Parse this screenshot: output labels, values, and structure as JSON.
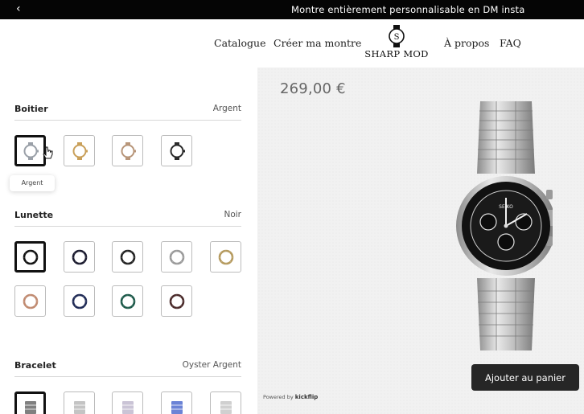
{
  "announcement": {
    "back_icon": "chevron-left-icon",
    "text": "Montre entièrement personnalisable en DM insta"
  },
  "nav": {
    "catalogue": "Catalogue",
    "create": "Créer ma montre",
    "about": "À propos",
    "faq": "FAQ",
    "logo_text": "SHARP MOD"
  },
  "configurator": {
    "sections": [
      {
        "title": "Boitier",
        "value": "Argent",
        "options": [
          {
            "name": "Argent",
            "color": "#9aa0a8",
            "selected": true
          },
          {
            "name": "Or",
            "color": "#c9a05a",
            "selected": false
          },
          {
            "name": "Or rose",
            "color": "#b8967a",
            "selected": false
          },
          {
            "name": "Noir",
            "color": "#2a2a2a",
            "selected": false
          }
        ]
      },
      {
        "title": "Lunette",
        "value": "Noir",
        "options": [
          {
            "color": "#111111",
            "selected": true
          },
          {
            "color": "#1a1a2e",
            "selected": false
          },
          {
            "color": "#222222",
            "selected": false
          },
          {
            "color": "#9a9a9a",
            "selected": false
          },
          {
            "color": "#b59a5e",
            "selected": false
          },
          {
            "color": "#c08a70",
            "selected": false
          },
          {
            "color": "#1f2a55",
            "selected": false
          },
          {
            "color": "#1d5a4a",
            "selected": false
          },
          {
            "color": "#4a2a2a",
            "selected": false
          }
        ]
      },
      {
        "title": "Bracelet",
        "value": "Oyster Argent",
        "options": [
          {
            "color": "#555555",
            "selected": true
          },
          {
            "color": "#b0b0b0",
            "selected": false
          },
          {
            "color": "#b8b0c8",
            "selected": false
          },
          {
            "color": "#3a5ac8",
            "selected": false
          },
          {
            "color": "#c0c0c0",
            "selected": false
          }
        ]
      }
    ],
    "tooltip": "Argent"
  },
  "preview": {
    "price": "269,00 €",
    "add_to_cart": "Ajouter au panier",
    "powered_prefix": "Powered by",
    "powered_brand": "kickflip",
    "dial_brand": "SEIKO"
  },
  "colors": {
    "topbar": "#050505",
    "button": "#262626",
    "preview_bg": "#f1f1f1"
  }
}
